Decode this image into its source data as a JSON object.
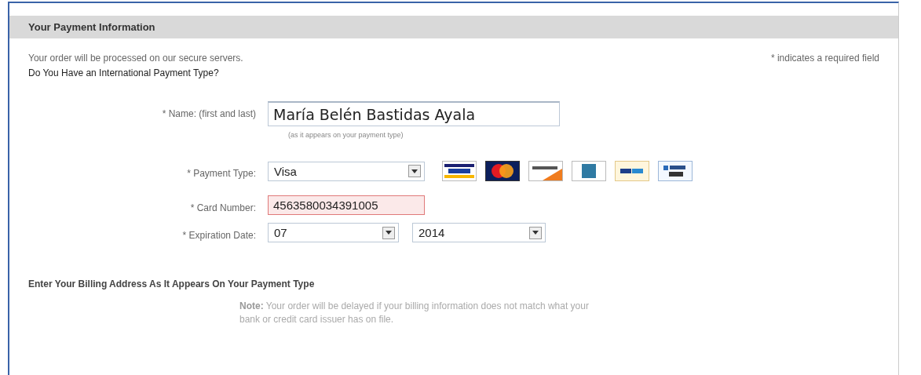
{
  "section_title": "Your Payment Information",
  "intro": "Your order will be processed on our secure servers.",
  "required_note": "* indicates a required field",
  "international_link": "Do You Have an International Payment Type?",
  "fields": [
    {
      "kind": "text",
      "label": "* Name: (first and last)",
      "value": "María Belén Bastidas Ayala",
      "hint": "(as it appears on your payment type)"
    },
    {
      "kind": "select",
      "label": "* Payment Type:",
      "value": "Visa"
    },
    {
      "kind": "text",
      "label": "* Card Number:",
      "value": "4563580034391005",
      "error": true
    },
    {
      "kind": "date",
      "label": "* Expiration Date:",
      "month": "07",
      "year": "2014"
    }
  ],
  "billing_title": "Enter Your Billing Address As It Appears On Your Payment Type",
  "note_label": "Note:",
  "note_text": "Your order will be delayed if your billing information does not match what your bank or credit card issuer has on file."
}
